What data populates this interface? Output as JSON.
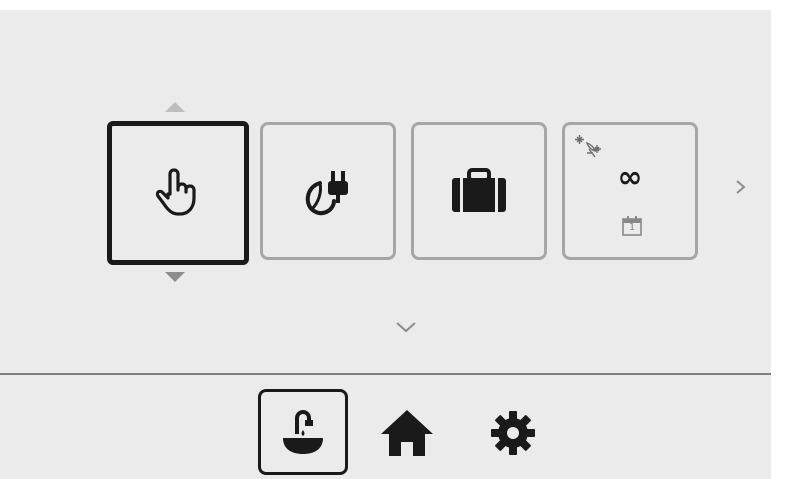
{
  "modes": {
    "items": [
      {
        "icon": "hand-pointer-icon",
        "selected": true
      },
      {
        "icon": "eco-plug-icon",
        "selected": false
      },
      {
        "icon": "suitcase-icon",
        "selected": false
      },
      {
        "icon": "infinity-icon",
        "label": "∞",
        "calendar_day": "1",
        "selected": false
      }
    ]
  },
  "nav": {
    "items": [
      {
        "icon": "tap-water-icon",
        "active": true
      },
      {
        "icon": "home-icon",
        "active": false
      },
      {
        "icon": "gear-icon",
        "active": false
      }
    ]
  },
  "colors": {
    "background": "#ebebeb",
    "tile_border": "#a6a6a6",
    "selected_border": "#1a1a1a",
    "icon": "#1a1a1a",
    "muted": "#8c8c8c"
  }
}
